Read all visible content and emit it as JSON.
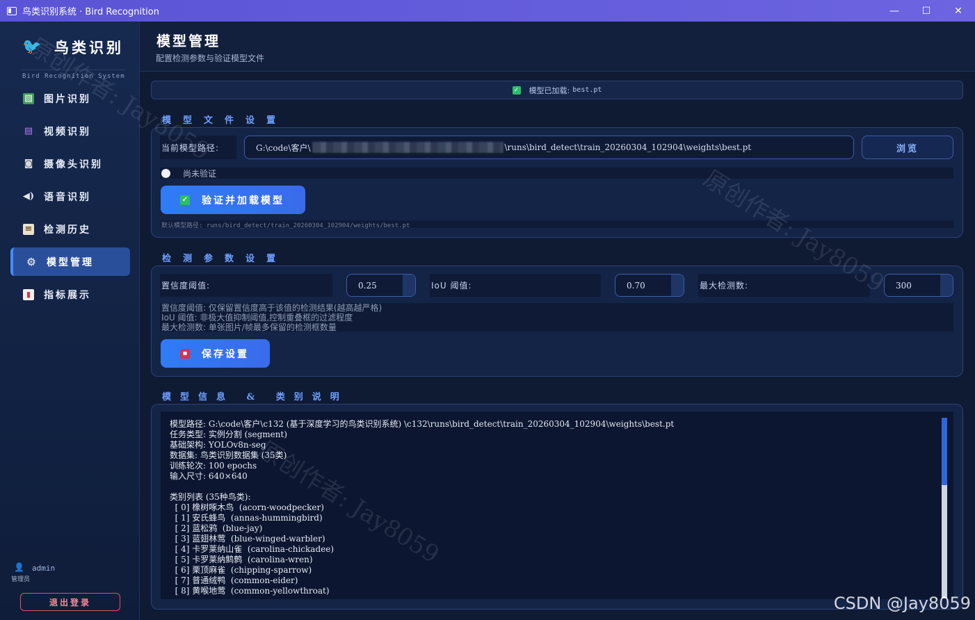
{
  "window": {
    "title": "鸟类识别系统 · Bird Recognition"
  },
  "sidebar": {
    "logo_title": "鸟类识别",
    "logo_subtitle": "Bird Recognition System",
    "items": [
      {
        "label": "图片识别",
        "icon": "image-icon"
      },
      {
        "label": "视频识别",
        "icon": "film-icon"
      },
      {
        "label": "摄像头识别",
        "icon": "camera-icon"
      },
      {
        "label": "语音识别",
        "icon": "speaker-icon"
      },
      {
        "label": "检测历史",
        "icon": "clipboard-icon"
      },
      {
        "label": "模型管理",
        "icon": "gear-icon",
        "active": true
      },
      {
        "label": "指标展示",
        "icon": "bar-chart-icon"
      }
    ],
    "user_name": "admin",
    "user_role": "管理员",
    "logout_label": "退出登录"
  },
  "header": {
    "title": "模型管理",
    "subtitle": "配置检测参数与验证模型文件"
  },
  "status": {
    "prefix": "模型已加载:",
    "filename": "best.pt",
    "color": "#2bbd6a"
  },
  "model_file": {
    "section_title": "模型文件设置",
    "path_label": "当前模型路径:",
    "path_start": "G:\\code\\客户\\",
    "path_end": "\\runs\\bird_detect\\train_20260304_102904\\weights\\best.pt",
    "browse_label": "浏览",
    "verify_status": "尚未验证",
    "verify_button": "验证并加载模型",
    "default_path_hint": "默认模型路径: runs/bird_detect/train_20260304_102904/weights/best.pt"
  },
  "detect_params": {
    "section_title": "检测参数设置",
    "conf_label": "置信度阈值:",
    "conf_value": "0.25",
    "iou_label": "IoU 阈值:",
    "iou_value": "0.70",
    "maxdet_label": "最大检测数:",
    "maxdet_value": "300",
    "desc_1": "置信度阈值: 仅保留置信度高于该值的检测结果(越高越严格)",
    "desc_2": "IoU 阈值: 非极大值抑制阈值,控制重叠框的过滤程度",
    "desc_3": "最大检测数: 单张图片/帧最多保留的检测框数量",
    "save_button": "保存设置"
  },
  "model_info": {
    "section_title": "模型信息 & 类别说明",
    "text": "模型路径: G:\\code\\客户\\c132 (基于深度学习的鸟类识别系统) \\c132\\runs\\bird_detect\\train_20260304_102904\\weights\\best.pt\n任务类型: 实例分割 (segment)\n基础架构: YOLOv8n-seg\n数据集: 鸟类识别数据集 (35类)\n训练轮次: 100 epochs\n输入尺寸: 640×640\n\n类别列表 (35种鸟类):\n  [ 0] 橡树啄木鸟  (acorn-woodpecker)\n  [ 1] 安氏蜂鸟  (annas-hummingbird)\n  [ 2] 蓝松鸦  (blue-jay)\n  [ 3] 蓝翅林莺  (blue-winged-warbler)\n  [ 4] 卡罗莱纳山雀  (carolina-chickadee)\n  [ 5] 卡罗莱纳鹪鹩  (carolina-wren)\n  [ 6] 栗顶麻雀  (chipping-sparrow)\n  [ 7] 普通绒鸭  (common-eider)\n  [ 8] 黄喉地莺  (common-yellowthroat)"
  },
  "watermarks": {
    "text_1": "原创作者: Jay8059",
    "text_2": "原创作者: Jay8059",
    "text_3": "原创作者: Jay8059"
  },
  "footer_watermark": "CSDN @Jay8059"
}
